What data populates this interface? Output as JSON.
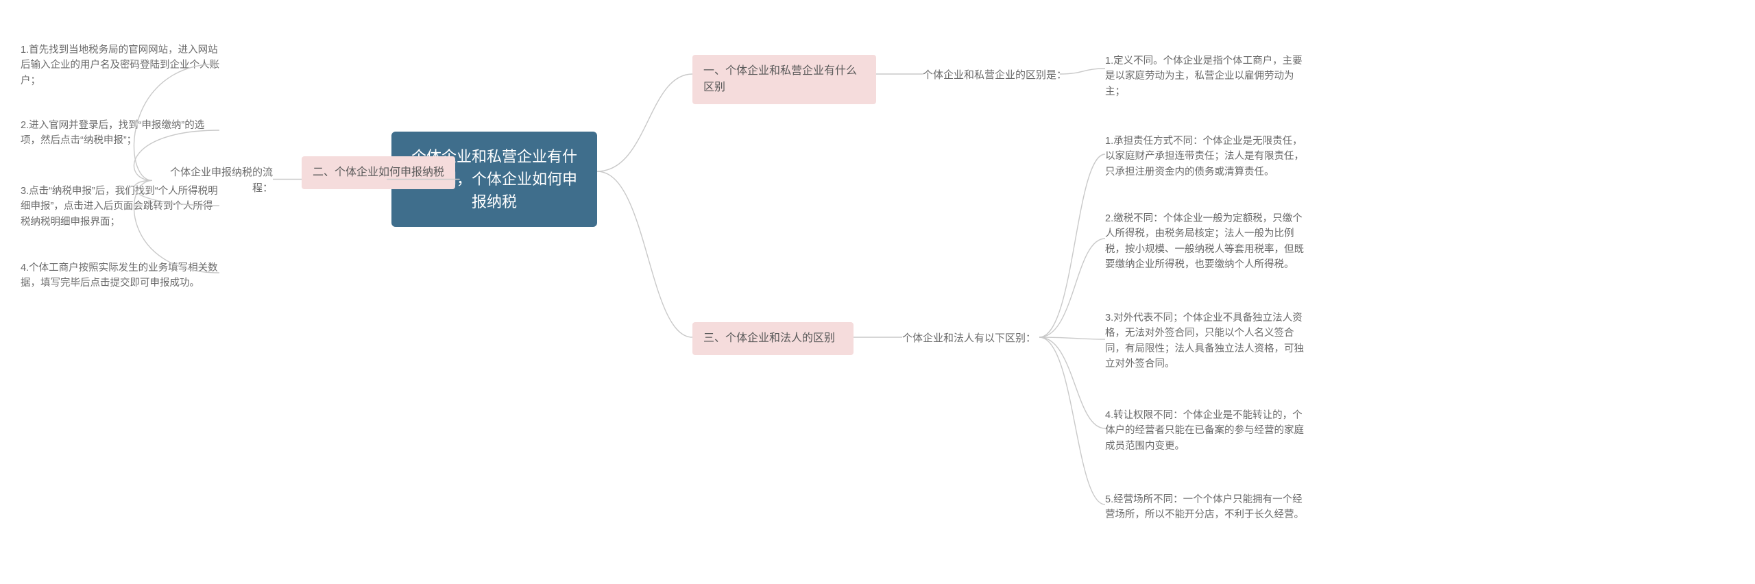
{
  "root": "个体企业和私营企业有什么区别，个体企业如何申报纳税",
  "branch1": {
    "title": "一、个体企业和私营企业有什么区别",
    "sub": "个体企业和私营企业的区别是：",
    "leaves": [
      "1.定义不同。个体企业是指个体工商户，主要是以家庭劳动为主，私营企业以雇佣劳动为主；"
    ]
  },
  "branch2": {
    "title": "二、个体企业如何申报纳税",
    "sub": "个体企业申报纳税的流程：",
    "leaves": [
      "1.首先找到当地税务局的官网网站，进入网站后输入企业的用户名及密码登陆到企业个人账户；",
      "2.进入官网并登录后，找到“申报缴纳”的选项，然后点击“纳税申报”；",
      "3.点击“纳税申报”后，我们找到“个人所得税明细申报”，点击进入后页面会跳转到个人所得税纳税明细申报界面；",
      "4.个体工商户按照实际发生的业务填写相关数据，填写完毕后点击提交即可申报成功。"
    ]
  },
  "branch3": {
    "title": "三、个体企业和法人的区别",
    "sub": "个体企业和法人有以下区别：",
    "leaves": [
      "1.承担责任方式不同：个体企业是无限责任，以家庭财产承担连带责任；法人是有限责任，只承担注册资金内的债务或清算责任。",
      "2.缴税不同：个体企业一般为定额税，只缴个人所得税，由税务局核定；法人一般为比例税，按小规模、一般纳税人等套用税率，但既要缴纳企业所得税，也要缴纳个人所得税。",
      "3.对外代表不同；个体企业不具备独立法人资格，无法对外签合同，只能以个人名义签合同，有局限性；法人具备独立法人资格，可独立对外签合同。",
      "4.转让权限不同：个体企业是不能转让的，个体户的经营者只能在已备案的参与经营的家庭成员范围内变更。",
      "5.经营场所不同：一个个体户只能拥有一个经营场所，所以不能开分店，不利于长久经营。"
    ]
  }
}
